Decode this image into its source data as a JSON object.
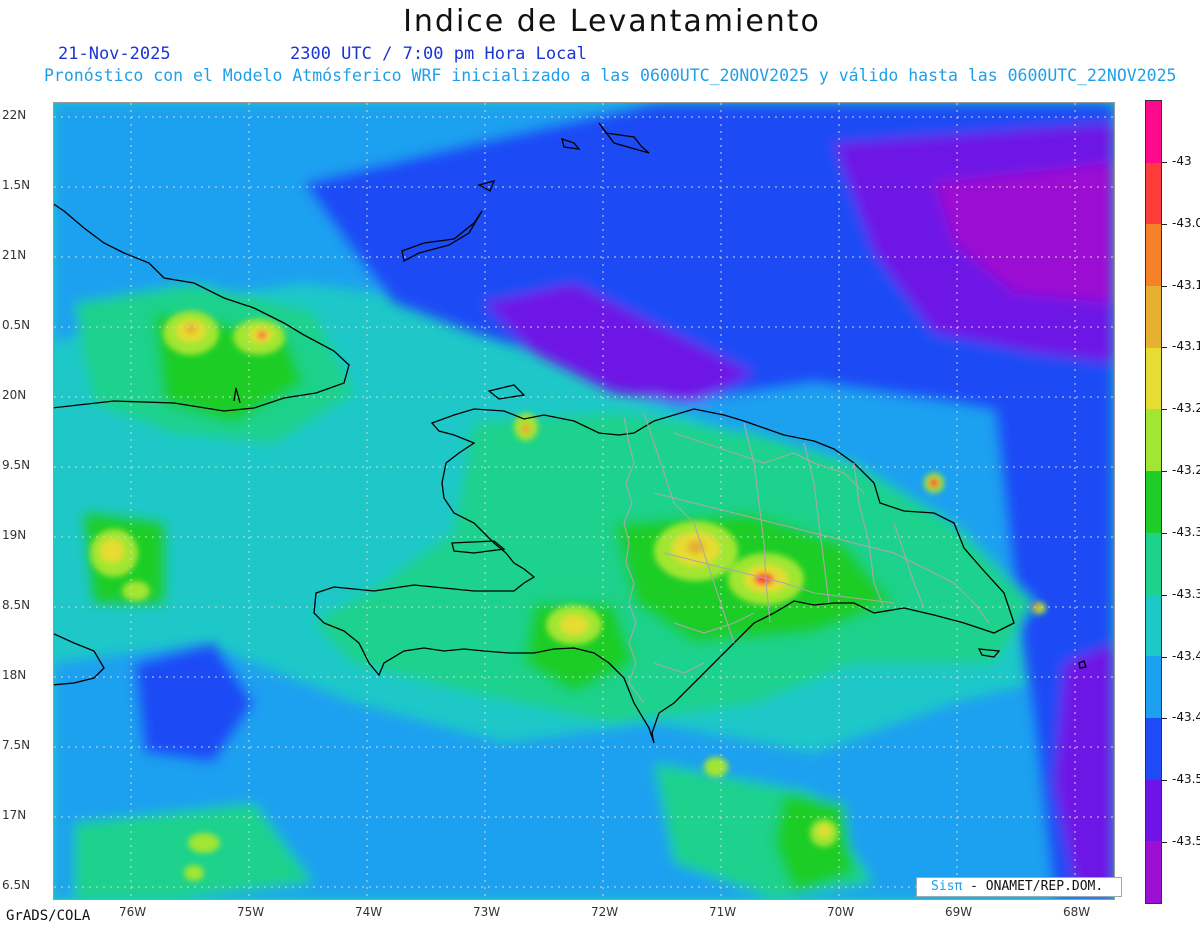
{
  "header": {
    "title": "Indice de Levantamiento",
    "date": "21-Nov-2025",
    "time": "2300 UTC / 7:00 pm Hora Local",
    "subtitle": "Pronóstico con el Modelo Atmósferico WRF inicializado a las 0600UTC_20NOV2025 y válido hasta las  0600UTC_22NOV2025"
  },
  "map": {
    "lat_labels": [
      "22N",
      "1.5N",
      "21N",
      "0.5N",
      "20N",
      "9.5N",
      "19N",
      "8.5N",
      "18N",
      "7.5N",
      "17N",
      "6.5N"
    ],
    "lon_labels": [
      "76W",
      "75W",
      "74W",
      "73W",
      "72W",
      "71W",
      "70W",
      "69W",
      "68W"
    ],
    "colors": {
      "background_field": "#1fa8f0",
      "coastline": "#000000",
      "province_borders": "#a8a8a8",
      "gridlines": "#d8d8d8"
    }
  },
  "colorbar": {
    "levels": [
      "-43",
      "-43.0",
      "-43.1",
      "-43.1",
      "-43.2",
      "-43.2",
      "-43.3",
      "-43.3",
      "-43.4",
      "-43.4",
      "-43.5",
      "-43.5"
    ],
    "colors": [
      "#ff0a8c",
      "#ff3c3c",
      "#f58229",
      "#e6b030",
      "#e6dc32",
      "#a0e632",
      "#1ecd28",
      "#1ed28c",
      "#1ec8c8",
      "#1ea0f0",
      "#1e4bf5",
      "#6e14e6",
      "#9b10d2"
    ]
  },
  "footer": {
    "software": "GrADS/COLA",
    "credit_brand": "Sisπ",
    "credit_text": "- ONAMET/REP.DOM."
  }
}
